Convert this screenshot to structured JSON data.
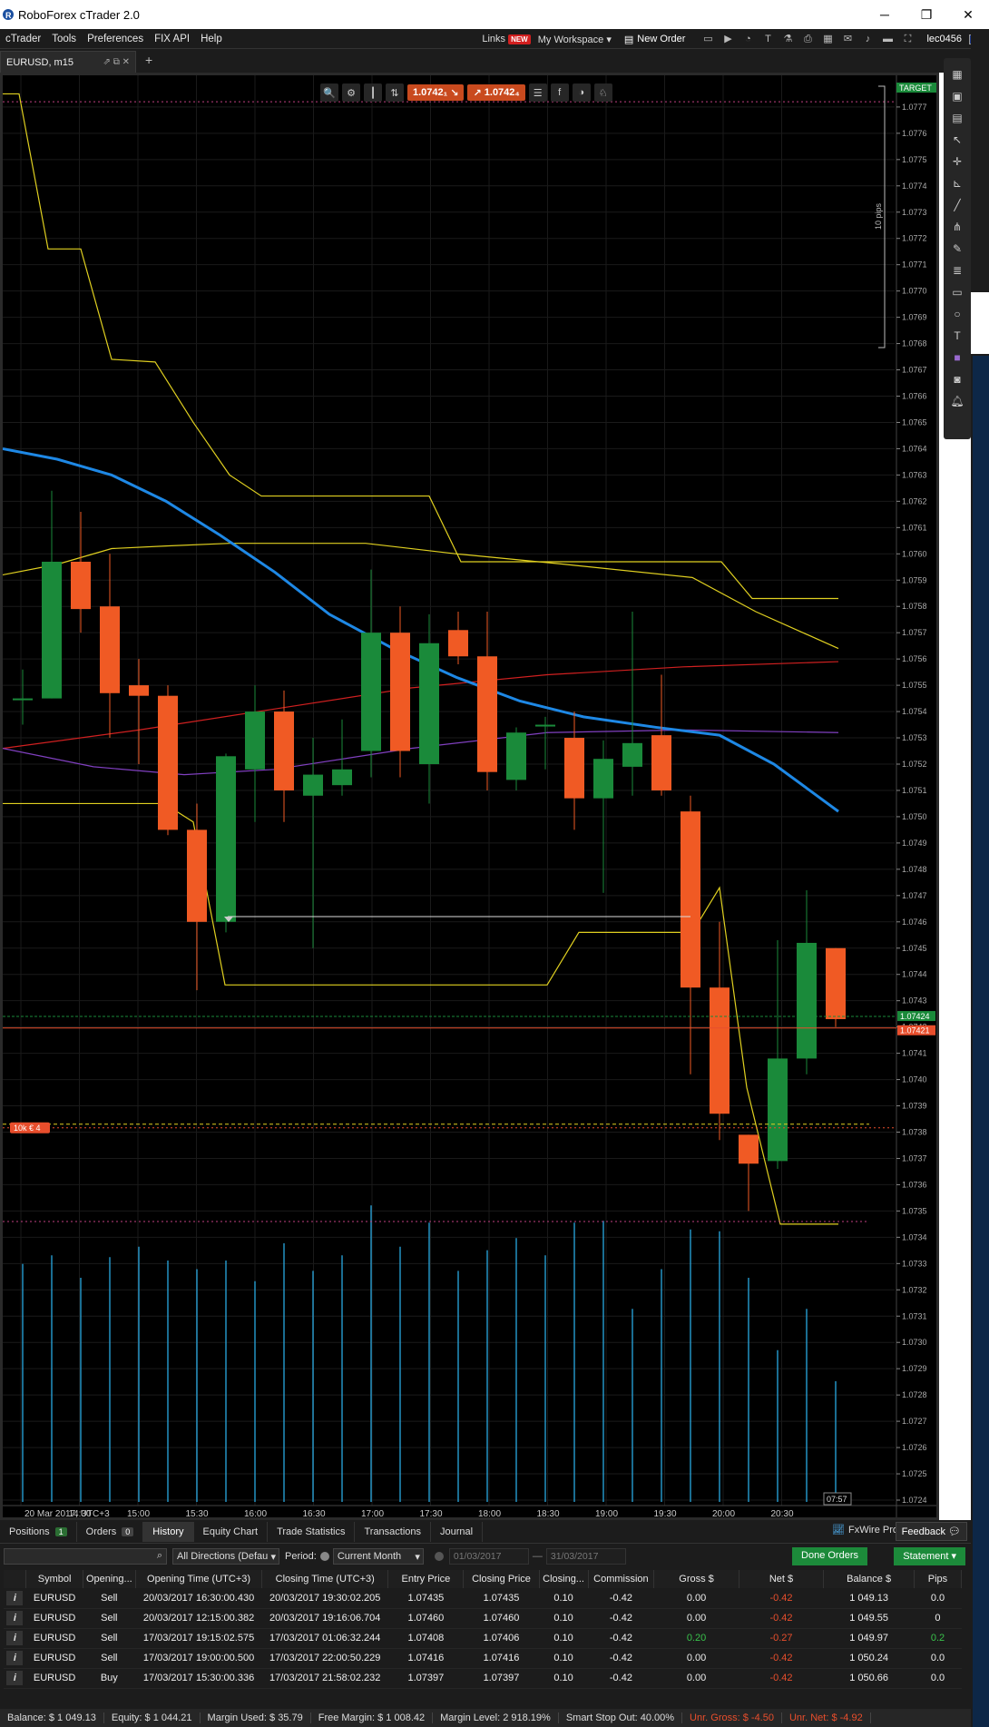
{
  "window": {
    "title": "RoboForex cTrader 2.0"
  },
  "menu": {
    "items": [
      "cTrader",
      "Tools",
      "Preferences",
      "FIX API",
      "Help"
    ],
    "links_label": "Links",
    "new_badge": "NEW",
    "workspace_label": "My Workspace ▾",
    "new_order_label": "New Order",
    "user": "lec0456"
  },
  "chart_tab": {
    "label": "EURUSD, m15"
  },
  "toolbar": {
    "sell_price": "1.0742₁",
    "buy_price": "1.0742₄"
  },
  "chart_data": {
    "type": "candlestick",
    "symbol": "EURUSD",
    "timeframe": "m15",
    "y_ticks": [
      "1.0777",
      "1.0776",
      "1.0775",
      "1.0774",
      "1.0773",
      "1.0772",
      "1.0771",
      "1.0770",
      "1.0769",
      "1.0768",
      "1.0767",
      "1.0766",
      "1.0765",
      "1.0764",
      "1.0763",
      "1.0762",
      "1.0761",
      "1.0760",
      "1.0759",
      "1.0758",
      "1.0757",
      "1.0756",
      "1.0755",
      "1.0754",
      "1.0753",
      "1.0752",
      "1.0751",
      "1.0750",
      "1.0749",
      "1.0748",
      "1.0747",
      "1.0746",
      "1.0745",
      "1.0744",
      "1.0743",
      "1.0742",
      "1.0741",
      "1.0740",
      "1.0739",
      "1.0738",
      "1.0737",
      "1.0736",
      "1.0735",
      "1.0734",
      "1.0733",
      "1.0732",
      "1.0731",
      "1.0730",
      "1.0729",
      "1.0728",
      "1.0727",
      "1.0726",
      "1.0725",
      "1.0724"
    ],
    "x_labels": [
      "20 Mar 2017, UTC+3",
      "14:30",
      "15:00",
      "15:30",
      "16:00",
      "16:30",
      "17:00",
      "17:30",
      "18:00",
      "18:30",
      "19:00",
      "19:30",
      "20:00",
      "20:30"
    ],
    "ask_label": "1.07424",
    "bid_label": "1.07421",
    "time_remaining": "07:57",
    "pips_label": "10 pips",
    "target_label": "TARGET",
    "position_label": "10k € 4",
    "candles": [
      {
        "o": 1.07545,
        "h": 1.07556,
        "l": 1.07535,
        "c": 1.07545
      },
      {
        "o": 1.07545,
        "h": 1.07624,
        "l": 1.07545,
        "c": 1.07597
      },
      {
        "o": 1.07597,
        "h": 1.07616,
        "l": 1.0757,
        "c": 1.07579
      },
      {
        "o": 1.0758,
        "h": 1.076,
        "l": 1.0753,
        "c": 1.07547
      },
      {
        "o": 1.0755,
        "h": 1.0756,
        "l": 1.0752,
        "c": 1.07546
      },
      {
        "o": 1.07546,
        "h": 1.0755,
        "l": 1.07493,
        "c": 1.07495
      },
      {
        "o": 1.07495,
        "h": 1.07505,
        "l": 1.07434,
        "c": 1.0746
      },
      {
        "o": 1.0746,
        "h": 1.07524,
        "l": 1.07456,
        "c": 1.07523
      },
      {
        "o": 1.07518,
        "h": 1.0755,
        "l": 1.07498,
        "c": 1.0754
      },
      {
        "o": 1.0754,
        "h": 1.07548,
        "l": 1.07498,
        "c": 1.0751
      },
      {
        "o": 1.07508,
        "h": 1.0753,
        "l": 1.0745,
        "c": 1.07516
      },
      {
        "o": 1.07512,
        "h": 1.07537,
        "l": 1.07508,
        "c": 1.07518
      },
      {
        "o": 1.07525,
        "h": 1.07594,
        "l": 1.07515,
        "c": 1.0757
      },
      {
        "o": 1.0757,
        "h": 1.0758,
        "l": 1.07515,
        "c": 1.07525
      },
      {
        "o": 1.0752,
        "h": 1.07577,
        "l": 1.07505,
        "c": 1.07566
      },
      {
        "o": 1.07571,
        "h": 1.07578,
        "l": 1.07558,
        "c": 1.07561
      },
      {
        "o": 1.07561,
        "h": 1.07578,
        "l": 1.0751,
        "c": 1.07517
      },
      {
        "o": 1.07514,
        "h": 1.07534,
        "l": 1.0751,
        "c": 1.07532
      },
      {
        "o": 1.07535,
        "h": 1.07538,
        "l": 1.07518,
        "c": 1.07535
      },
      {
        "o": 1.0753,
        "h": 1.0754,
        "l": 1.07495,
        "c": 1.07507
      },
      {
        "o": 1.07507,
        "h": 1.07529,
        "l": 1.07471,
        "c": 1.07522
      },
      {
        "o": 1.07519,
        "h": 1.07578,
        "l": 1.07508,
        "c": 1.07528
      },
      {
        "o": 1.07531,
        "h": 1.07554,
        "l": 1.07508,
        "c": 1.0751
      },
      {
        "o": 1.07502,
        "h": 1.07508,
        "l": 1.07402,
        "c": 1.07435
      },
      {
        "o": 1.07435,
        "h": 1.0746,
        "l": 1.07377,
        "c": 1.07387
      },
      {
        "o": 1.07379,
        "h": 1.07379,
        "l": 1.0735,
        "c": 1.07368
      },
      {
        "o": 1.07369,
        "h": 1.07453,
        "l": 1.07366,
        "c": 1.07408
      },
      {
        "o": 1.07408,
        "h": 1.07472,
        "l": 1.07402,
        "c": 1.07452
      },
      {
        "o": 1.0745,
        "h": 1.0745,
        "l": 1.0742,
        "c": 1.07423
      }
    ],
    "volumes": [
      138,
      143,
      130,
      142,
      148,
      140,
      135,
      140,
      128,
      150,
      134,
      143,
      172,
      148,
      162,
      134,
      146,
      153,
      143,
      162,
      163,
      112,
      135,
      158,
      157,
      130,
      88,
      112,
      70
    ]
  },
  "bottom": {
    "tabs": [
      {
        "label": "Positions",
        "count": "1"
      },
      {
        "label": "Orders",
        "count": "0"
      },
      {
        "label": "History"
      },
      {
        "label": "Equity Chart"
      },
      {
        "label": "Trade Statistics"
      },
      {
        "label": "Transactions"
      },
      {
        "label": "Journal"
      }
    ],
    "fxwire_label": "FxWire Pro",
    "feedback_label": "Feedback",
    "filters": {
      "direction": "All Directions (Defau",
      "period_label": "Period:",
      "period": "Current Month",
      "date_from": "01/03/2017",
      "date_to": "31/03/2017",
      "done_orders": "Done Orders",
      "statement": "Statement ▾"
    },
    "columns": [
      "Symbol",
      "Opening...",
      "Opening Time (UTC+3)",
      "Closing Time (UTC+3)",
      "Entry Price",
      "Closing Price",
      "Closing...",
      "Commission",
      "Gross $",
      "Net $",
      "Balance $",
      "Pips"
    ],
    "rows": [
      [
        "EURUSD",
        "Sell",
        "20/03/2017 16:30:00.430",
        "20/03/2017 19:30:02.205",
        "1.07435",
        "1.07435",
        "0.10",
        "-0.42",
        "0.00",
        "-0.42",
        "1 049.13",
        "0.0"
      ],
      [
        "EURUSD",
        "Sell",
        "20/03/2017 12:15:00.382",
        "20/03/2017 19:16:06.704",
        "1.07460",
        "1.07460",
        "0.10",
        "-0.42",
        "0.00",
        "-0.42",
        "1 049.55",
        "0"
      ],
      [
        "EURUSD",
        "Sell",
        "17/03/2017 19:15:02.575",
        "17/03/2017 01:06:32.244",
        "1.07408",
        "1.07406",
        "0.10",
        "-0.42",
        "0.20",
        "-0.27",
        "1 049.97",
        "0.2"
      ],
      [
        "EURUSD",
        "Sell",
        "17/03/2017 19:00:00.500",
        "17/03/2017 22:00:50.229",
        "1.07416",
        "1.07416",
        "0.10",
        "-0.42",
        "0.00",
        "-0.42",
        "1 050.24",
        "0.0"
      ],
      [
        "EURUSD",
        "Buy",
        "17/03/2017 15:30:00.336",
        "17/03/2017 21:58:02.232",
        "1.07397",
        "1.07397",
        "0.10",
        "-0.42",
        "0.00",
        "-0.42",
        "1 050.66",
        "0.0"
      ]
    ]
  },
  "status": {
    "balance": "Balance: $ 1 049.13",
    "equity": "Equity: $ 1 044.21",
    "margin_used": "Margin Used: $ 35.79",
    "free_margin": "Free Margin: $ 1 008.42",
    "margin_level": "Margin Level: 2 918.19%",
    "smart_stop": "Smart Stop Out: 40.00%",
    "unr_gross": "Unr. Gross: $ -4.50",
    "unr_net": "Unr. Net: $ -4.92"
  },
  "colors": {
    "bull": "#1a8a3a",
    "bear": "#f05a24",
    "ma_blue": "#1e88e5",
    "donchian": "#e0d020",
    "ma_red": "#d02020",
    "ma_purple": "#8040c0",
    "volume": "#29a8e0"
  }
}
